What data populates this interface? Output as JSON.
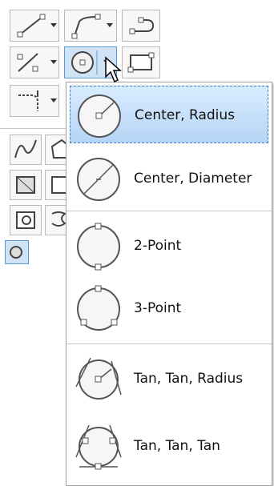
{
  "circle_menu": {
    "items": [
      {
        "label": "Center, Radius",
        "icon": "circle-center-radius-icon",
        "highlighted": true
      },
      {
        "label": "Center, Diameter",
        "icon": "circle-center-diameter-icon",
        "highlighted": false
      },
      {
        "label": "2-Point",
        "icon": "circle-2-point-icon",
        "highlighted": false
      },
      {
        "label": "3-Point",
        "icon": "circle-3-point-icon",
        "highlighted": false
      },
      {
        "label": "Tan, Tan, Radius",
        "icon": "circle-tan-tan-radius-icon",
        "highlighted": false
      },
      {
        "label": "Tan, Tan, Tan",
        "icon": "circle-tan-tan-tan-icon",
        "highlighted": false
      }
    ]
  },
  "colors": {
    "highlight_border": "#3a7bc8",
    "highlight_fill": "#cfe3f5",
    "button_border": "#b9b9b9"
  }
}
